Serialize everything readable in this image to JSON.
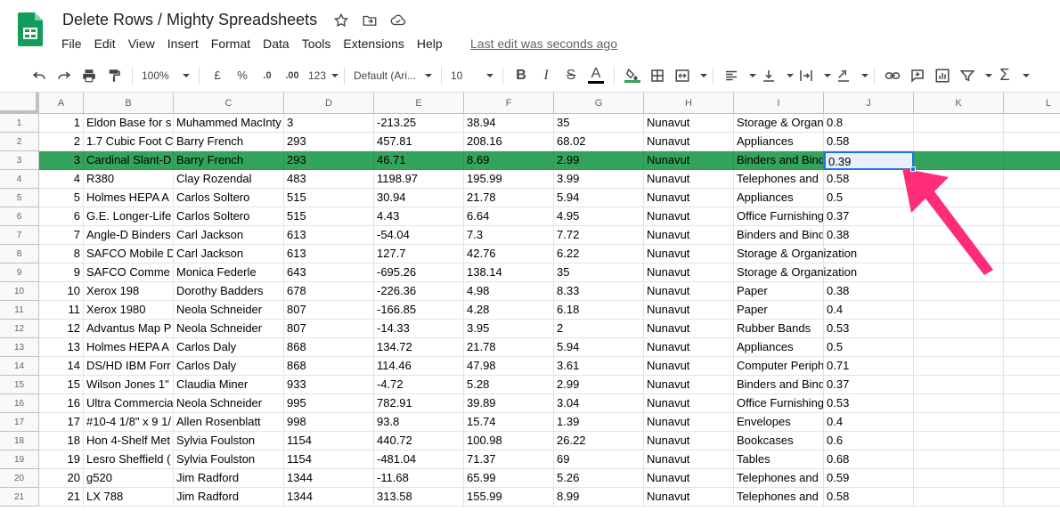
{
  "doc": {
    "title": "Delete Rows / Mighty Spreadsheets",
    "last_edit": "Last edit was seconds ago"
  },
  "menu": [
    "File",
    "Edit",
    "View",
    "Insert",
    "Format",
    "Data",
    "Tools",
    "Extensions",
    "Help"
  ],
  "toolbar": {
    "zoom": "100%",
    "currency": "£",
    "percent": "%",
    "dec_decrease": ".0",
    "dec_increase": ".00",
    "more_formats": "123",
    "font": "Default (Ari...",
    "font_size": "10",
    "bold": "B",
    "italic": "I",
    "strike": "S",
    "text_color_label": "A"
  },
  "colors": {
    "selected_row": "#34a45c",
    "selection_border": "#1a73e8",
    "arrow": "#ff2d78"
  },
  "columns": [
    "A",
    "B",
    "C",
    "D",
    "E",
    "F",
    "G",
    "H",
    "I",
    "J",
    "K",
    "L"
  ],
  "rows": [
    [
      "1",
      "Eldon Base for s",
      "Muhammed MacInty",
      "3",
      "-213.25",
      "38.94",
      "35",
      "Nunavut",
      "Storage & Organ",
      "0.8"
    ],
    [
      "2",
      "1.7 Cubic Foot C",
      "Barry French",
      "293",
      "457.81",
      "208.16",
      "68.02",
      "Nunavut",
      "Appliances",
      "0.58"
    ],
    [
      "3",
      "Cardinal Slant-D",
      "Barry French",
      "293",
      "46.71",
      "8.69",
      "2.99",
      "Nunavut",
      "Binders and Bind",
      "0.39"
    ],
    [
      "4",
      "R380",
      "Clay Rozendal",
      "483",
      "1198.97",
      "195.99",
      "3.99",
      "Nunavut",
      "Telephones and",
      "0.58"
    ],
    [
      "5",
      "Holmes HEPA A",
      "Carlos Soltero",
      "515",
      "30.94",
      "21.78",
      "5.94",
      "Nunavut",
      "Appliances",
      "0.5"
    ],
    [
      "6",
      "G.E. Longer-Life",
      "Carlos Soltero",
      "515",
      "4.43",
      "6.64",
      "4.95",
      "Nunavut",
      "Office Furnishing",
      "0.37"
    ],
    [
      "7",
      "Angle-D Binders",
      "Carl Jackson",
      "613",
      "-54.04",
      "7.3",
      "7.72",
      "Nunavut",
      "Binders and Bind",
      "0.38"
    ],
    [
      "8",
      "SAFCO Mobile D",
      "Carl Jackson",
      "613",
      "127.7",
      "42.76",
      "6.22",
      "Nunavut",
      "Storage & Organization",
      ""
    ],
    [
      "9",
      "SAFCO Comme",
      "Monica Federle",
      "643",
      "-695.26",
      "138.14",
      "35",
      "Nunavut",
      "Storage & Organization",
      ""
    ],
    [
      "10",
      "Xerox 198",
      "Dorothy Badders",
      "678",
      "-226.36",
      "4.98",
      "8.33",
      "Nunavut",
      "Paper",
      "0.38"
    ],
    [
      "11",
      "Xerox 1980",
      "Neola Schneider",
      "807",
      "-166.85",
      "4.28",
      "6.18",
      "Nunavut",
      "Paper",
      "0.4"
    ],
    [
      "12",
      "Advantus Map P",
      "Neola Schneider",
      "807",
      "-14.33",
      "3.95",
      "2",
      "Nunavut",
      "Rubber Bands",
      "0.53"
    ],
    [
      "13",
      "Holmes HEPA A",
      "Carlos Daly",
      "868",
      "134.72",
      "21.78",
      "5.94",
      "Nunavut",
      "Appliances",
      "0.5"
    ],
    [
      "14",
      "DS/HD IBM Forr",
      "Carlos Daly",
      "868",
      "114.46",
      "47.98",
      "3.61",
      "Nunavut",
      "Computer Periph",
      "0.71"
    ],
    [
      "15",
      "Wilson Jones 1\"",
      "Claudia Miner",
      "933",
      "-4.72",
      "5.28",
      "2.99",
      "Nunavut",
      "Binders and Bind",
      "0.37"
    ],
    [
      "16",
      "Ultra Commercia",
      "Neola Schneider",
      "995",
      "782.91",
      "39.89",
      "3.04",
      "Nunavut",
      "Office Furnishing",
      "0.53"
    ],
    [
      "17",
      "#10-4 1/8\" x 9 1/",
      "Allen Rosenblatt",
      "998",
      "93.8",
      "15.74",
      "1.39",
      "Nunavut",
      "Envelopes",
      "0.4"
    ],
    [
      "18",
      "Hon 4-Shelf Met",
      "Sylvia Foulston",
      "1154",
      "440.72",
      "100.98",
      "26.22",
      "Nunavut",
      "Bookcases",
      "0.6"
    ],
    [
      "19",
      "Lesro Sheffield (",
      "Sylvia Foulston",
      "1154",
      "-481.04",
      "71.37",
      "69",
      "Nunavut",
      "Tables",
      "0.68"
    ],
    [
      "20",
      "g520",
      "Jim Radford",
      "1344",
      "-11.68",
      "65.99",
      "5.26",
      "Nunavut",
      "Telephones and",
      "0.59"
    ],
    [
      "21",
      "LX 788",
      "Jim Radford",
      "1344",
      "313.58",
      "155.99",
      "8.99",
      "Nunavut",
      "Telephones and",
      "0.58"
    ]
  ],
  "selected_row_index": 2
}
